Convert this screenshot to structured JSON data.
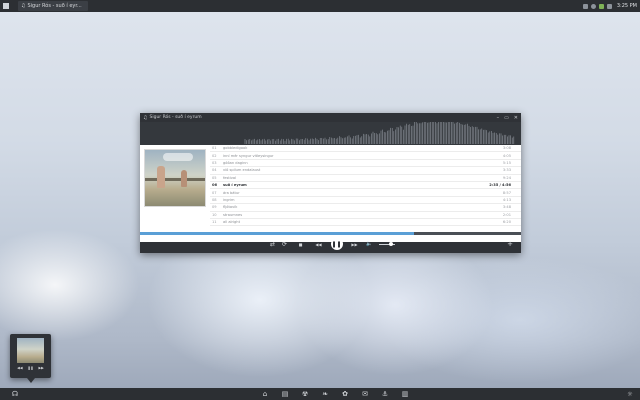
{
  "top_panel": {
    "task_title": "Sigur Rós - suð í eyr...",
    "clock": "3:25 PM"
  },
  "window": {
    "title": "Sigur Rós - suð í eyrum",
    "controls": {
      "minimize": "–",
      "maximize": "▭",
      "close": "✕"
    }
  },
  "tracks": [
    {
      "num": "01",
      "title": "gobbledigook",
      "dur": "3:08"
    },
    {
      "num": "02",
      "title": "inní mér syngur vitleysingur",
      "dur": "4:05"
    },
    {
      "num": "03",
      "title": "góðan daginn",
      "dur": "5:15"
    },
    {
      "num": "04",
      "title": "við spilum endalaust",
      "dur": "3:33"
    },
    {
      "num": "05",
      "title": "festival",
      "dur": "9:24"
    },
    {
      "num": "06",
      "title": "suð í eyrum",
      "dur": "2:35 / 4:56",
      "active": true
    },
    {
      "num": "07",
      "title": "ára bátur",
      "dur": "8:57"
    },
    {
      "num": "08",
      "title": "ingrim",
      "dur": "4:13"
    },
    {
      "num": "09",
      "title": "fljótavík",
      "dur": "3:48"
    },
    {
      "num": "10",
      "title": "straumnes",
      "dur": "2:01"
    },
    {
      "num": "11",
      "title": "all alright",
      "dur": "6:20"
    }
  ],
  "playback": {
    "progress": 0.72,
    "volume": 0.8,
    "shuffle_icon": "⇄",
    "repeat_icon": "⟳",
    "stop_icon": "■",
    "prev_icon": "◀◀",
    "pause_icon": "❚❚",
    "next_icon": "▶▶",
    "volume_icon": "🔈",
    "add_icon": "+"
  },
  "mini_player": {
    "prev_icon": "◀◀",
    "pause_icon": "❚❚",
    "next_icon": "▶▶"
  },
  "dock": {
    "left_icon": "☊",
    "items": [
      "⌂",
      "▤",
      "☢",
      "❧",
      "✿",
      "✉",
      "⚓",
      "▥"
    ],
    "right_icon": "☼"
  },
  "colors": {
    "panel": "#2c2f33",
    "window": "#2f3237",
    "accent": "#5a9fd6"
  }
}
